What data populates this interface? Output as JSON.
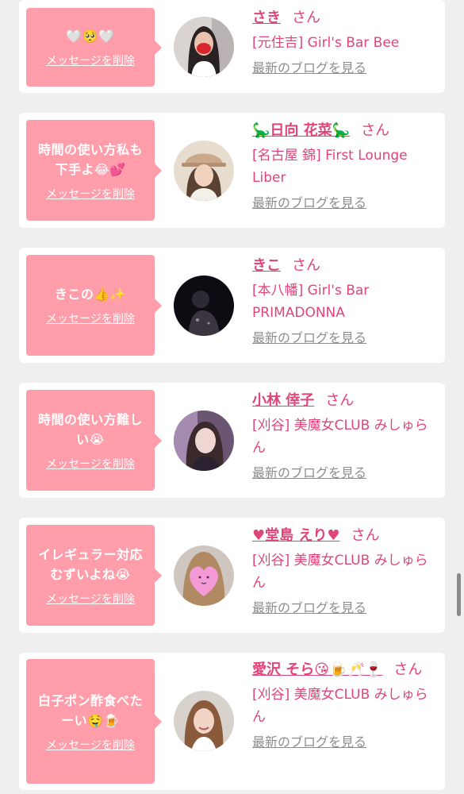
{
  "delete_label": "メッセージを削除",
  "blog_label": "最新のブログを見る",
  "honorific": "さん",
  "colors": {
    "page_bg": "#efefef",
    "bubble": "#ff9eaa",
    "name": "#e0457a",
    "link_gray": "#8d8d8d"
  },
  "messages": [
    {
      "text": "🤍🥺🤍",
      "name": "さき",
      "shop": "[元住吉] Girl's Bar Bee",
      "avatar_icon": "woman-red-mask-photo"
    },
    {
      "text": "時間の使い方私も下手よ😂💕",
      "name": "🦕日向 花菜🦕",
      "shop": "[名古屋 錦] First Lounge Liber",
      "avatar_icon": "woman-beige-cap-photo"
    },
    {
      "text": "きこの👍✨",
      "name": "きこ",
      "shop": "[本八幡] Girl's Bar PRIMADONNA",
      "avatar_icon": "dark-night-photo"
    },
    {
      "text": "時間の使い方難しい😭",
      "name": "小林 倖子",
      "shop": "[刈谷] 美魔女CLUB みしゅらん",
      "avatar_icon": "woman-purple-light-photo"
    },
    {
      "text": "イレギュラー対応むずいよね😭",
      "name": "♥堂島 えり♥",
      "shop": "[刈谷] 美魔女CLUB みしゅらん",
      "avatar_icon": "pink-heart-face-photo"
    },
    {
      "text": "白子ポン酢食べたーい🤤🍺",
      "name": "愛沢 そら😘🍺🥂🍷",
      "shop": "[刈谷] 美魔女CLUB みしゅらん",
      "avatar_icon": "woman-smiling-photo"
    }
  ]
}
